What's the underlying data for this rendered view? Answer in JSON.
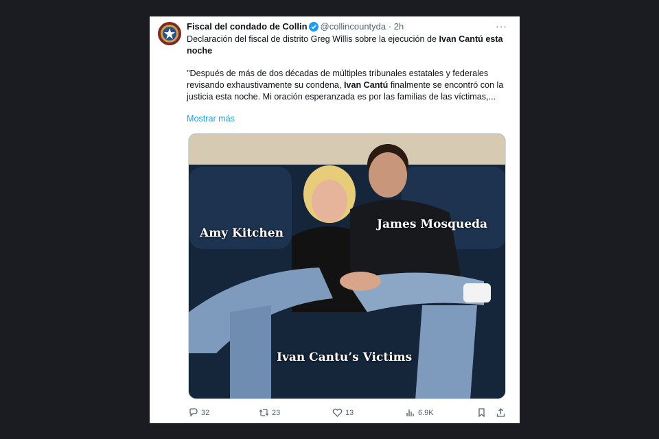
{
  "tweet": {
    "author_name": "Fiscal del condado de Collin",
    "handle": "@collincountyda",
    "separator": "·",
    "time": "2h",
    "more_menu": "···",
    "text_line1_pre": "Declaración del fiscal de distrito Greg Willis sobre la ejecución de ",
    "text_line1_bold": "Ivan Cantú esta noche",
    "text_p2_pre": "\"Después de más de dos décadas de múltiples tribunales estatales y federales revisando exhaustivamente su condena, ",
    "text_p2_bold": "Ivan Cantú",
    "text_p2_post": " finalmente se encontró con la justicia esta noche. Mi oración esperanzada es por las familias de las víctimas,...",
    "show_more": "Mostrar más"
  },
  "media": {
    "label_left": "Amy Kitchen",
    "label_right": "James Mosqueda",
    "label_bottom": "Ivan Cantu’s Victims"
  },
  "actions": {
    "replies": "32",
    "reposts": "23",
    "likes": "13",
    "views": "6.9K"
  },
  "icons": [
    "seal-icon",
    "verified-badge-icon",
    "reply-icon",
    "repost-icon",
    "like-icon",
    "views-icon",
    "bookmark-icon",
    "share-icon"
  ],
  "colors": {
    "link": "#1d9bf0",
    "text": "#0f1419",
    "muted": "#536471",
    "background": "#1b1c22"
  }
}
